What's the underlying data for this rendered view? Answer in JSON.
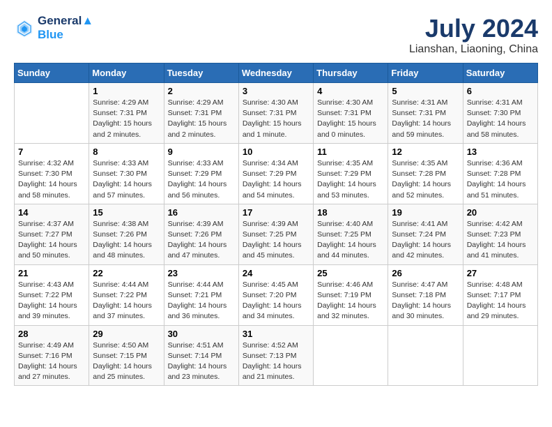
{
  "header": {
    "logo_line1": "General",
    "logo_line2": "Blue",
    "month_year": "July 2024",
    "location": "Lianshan, Liaoning, China"
  },
  "weekdays": [
    "Sunday",
    "Monday",
    "Tuesday",
    "Wednesday",
    "Thursday",
    "Friday",
    "Saturday"
  ],
  "weeks": [
    [
      {
        "day": "",
        "sunrise": "",
        "sunset": "",
        "daylight": ""
      },
      {
        "day": "1",
        "sunrise": "Sunrise: 4:29 AM",
        "sunset": "Sunset: 7:31 PM",
        "daylight": "Daylight: 15 hours and 2 minutes."
      },
      {
        "day": "2",
        "sunrise": "Sunrise: 4:29 AM",
        "sunset": "Sunset: 7:31 PM",
        "daylight": "Daylight: 15 hours and 2 minutes."
      },
      {
        "day": "3",
        "sunrise": "Sunrise: 4:30 AM",
        "sunset": "Sunset: 7:31 PM",
        "daylight": "Daylight: 15 hours and 1 minute."
      },
      {
        "day": "4",
        "sunrise": "Sunrise: 4:30 AM",
        "sunset": "Sunset: 7:31 PM",
        "daylight": "Daylight: 15 hours and 0 minutes."
      },
      {
        "day": "5",
        "sunrise": "Sunrise: 4:31 AM",
        "sunset": "Sunset: 7:31 PM",
        "daylight": "Daylight: 14 hours and 59 minutes."
      },
      {
        "day": "6",
        "sunrise": "Sunrise: 4:31 AM",
        "sunset": "Sunset: 7:30 PM",
        "daylight": "Daylight: 14 hours and 58 minutes."
      }
    ],
    [
      {
        "day": "7",
        "sunrise": "Sunrise: 4:32 AM",
        "sunset": "Sunset: 7:30 PM",
        "daylight": "Daylight: 14 hours and 58 minutes."
      },
      {
        "day": "8",
        "sunrise": "Sunrise: 4:33 AM",
        "sunset": "Sunset: 7:30 PM",
        "daylight": "Daylight: 14 hours and 57 minutes."
      },
      {
        "day": "9",
        "sunrise": "Sunrise: 4:33 AM",
        "sunset": "Sunset: 7:29 PM",
        "daylight": "Daylight: 14 hours and 56 minutes."
      },
      {
        "day": "10",
        "sunrise": "Sunrise: 4:34 AM",
        "sunset": "Sunset: 7:29 PM",
        "daylight": "Daylight: 14 hours and 54 minutes."
      },
      {
        "day": "11",
        "sunrise": "Sunrise: 4:35 AM",
        "sunset": "Sunset: 7:29 PM",
        "daylight": "Daylight: 14 hours and 53 minutes."
      },
      {
        "day": "12",
        "sunrise": "Sunrise: 4:35 AM",
        "sunset": "Sunset: 7:28 PM",
        "daylight": "Daylight: 14 hours and 52 minutes."
      },
      {
        "day": "13",
        "sunrise": "Sunrise: 4:36 AM",
        "sunset": "Sunset: 7:28 PM",
        "daylight": "Daylight: 14 hours and 51 minutes."
      }
    ],
    [
      {
        "day": "14",
        "sunrise": "Sunrise: 4:37 AM",
        "sunset": "Sunset: 7:27 PM",
        "daylight": "Daylight: 14 hours and 50 minutes."
      },
      {
        "day": "15",
        "sunrise": "Sunrise: 4:38 AM",
        "sunset": "Sunset: 7:26 PM",
        "daylight": "Daylight: 14 hours and 48 minutes."
      },
      {
        "day": "16",
        "sunrise": "Sunrise: 4:39 AM",
        "sunset": "Sunset: 7:26 PM",
        "daylight": "Daylight: 14 hours and 47 minutes."
      },
      {
        "day": "17",
        "sunrise": "Sunrise: 4:39 AM",
        "sunset": "Sunset: 7:25 PM",
        "daylight": "Daylight: 14 hours and 45 minutes."
      },
      {
        "day": "18",
        "sunrise": "Sunrise: 4:40 AM",
        "sunset": "Sunset: 7:25 PM",
        "daylight": "Daylight: 14 hours and 44 minutes."
      },
      {
        "day": "19",
        "sunrise": "Sunrise: 4:41 AM",
        "sunset": "Sunset: 7:24 PM",
        "daylight": "Daylight: 14 hours and 42 minutes."
      },
      {
        "day": "20",
        "sunrise": "Sunrise: 4:42 AM",
        "sunset": "Sunset: 7:23 PM",
        "daylight": "Daylight: 14 hours and 41 minutes."
      }
    ],
    [
      {
        "day": "21",
        "sunrise": "Sunrise: 4:43 AM",
        "sunset": "Sunset: 7:22 PM",
        "daylight": "Daylight: 14 hours and 39 minutes."
      },
      {
        "day": "22",
        "sunrise": "Sunrise: 4:44 AM",
        "sunset": "Sunset: 7:22 PM",
        "daylight": "Daylight: 14 hours and 37 minutes."
      },
      {
        "day": "23",
        "sunrise": "Sunrise: 4:44 AM",
        "sunset": "Sunset: 7:21 PM",
        "daylight": "Daylight: 14 hours and 36 minutes."
      },
      {
        "day": "24",
        "sunrise": "Sunrise: 4:45 AM",
        "sunset": "Sunset: 7:20 PM",
        "daylight": "Daylight: 14 hours and 34 minutes."
      },
      {
        "day": "25",
        "sunrise": "Sunrise: 4:46 AM",
        "sunset": "Sunset: 7:19 PM",
        "daylight": "Daylight: 14 hours and 32 minutes."
      },
      {
        "day": "26",
        "sunrise": "Sunrise: 4:47 AM",
        "sunset": "Sunset: 7:18 PM",
        "daylight": "Daylight: 14 hours and 30 minutes."
      },
      {
        "day": "27",
        "sunrise": "Sunrise: 4:48 AM",
        "sunset": "Sunset: 7:17 PM",
        "daylight": "Daylight: 14 hours and 29 minutes."
      }
    ],
    [
      {
        "day": "28",
        "sunrise": "Sunrise: 4:49 AM",
        "sunset": "Sunset: 7:16 PM",
        "daylight": "Daylight: 14 hours and 27 minutes."
      },
      {
        "day": "29",
        "sunrise": "Sunrise: 4:50 AM",
        "sunset": "Sunset: 7:15 PM",
        "daylight": "Daylight: 14 hours and 25 minutes."
      },
      {
        "day": "30",
        "sunrise": "Sunrise: 4:51 AM",
        "sunset": "Sunset: 7:14 PM",
        "daylight": "Daylight: 14 hours and 23 minutes."
      },
      {
        "day": "31",
        "sunrise": "Sunrise: 4:52 AM",
        "sunset": "Sunset: 7:13 PM",
        "daylight": "Daylight: 14 hours and 21 minutes."
      },
      {
        "day": "",
        "sunrise": "",
        "sunset": "",
        "daylight": ""
      },
      {
        "day": "",
        "sunrise": "",
        "sunset": "",
        "daylight": ""
      },
      {
        "day": "",
        "sunrise": "",
        "sunset": "",
        "daylight": ""
      }
    ]
  ]
}
